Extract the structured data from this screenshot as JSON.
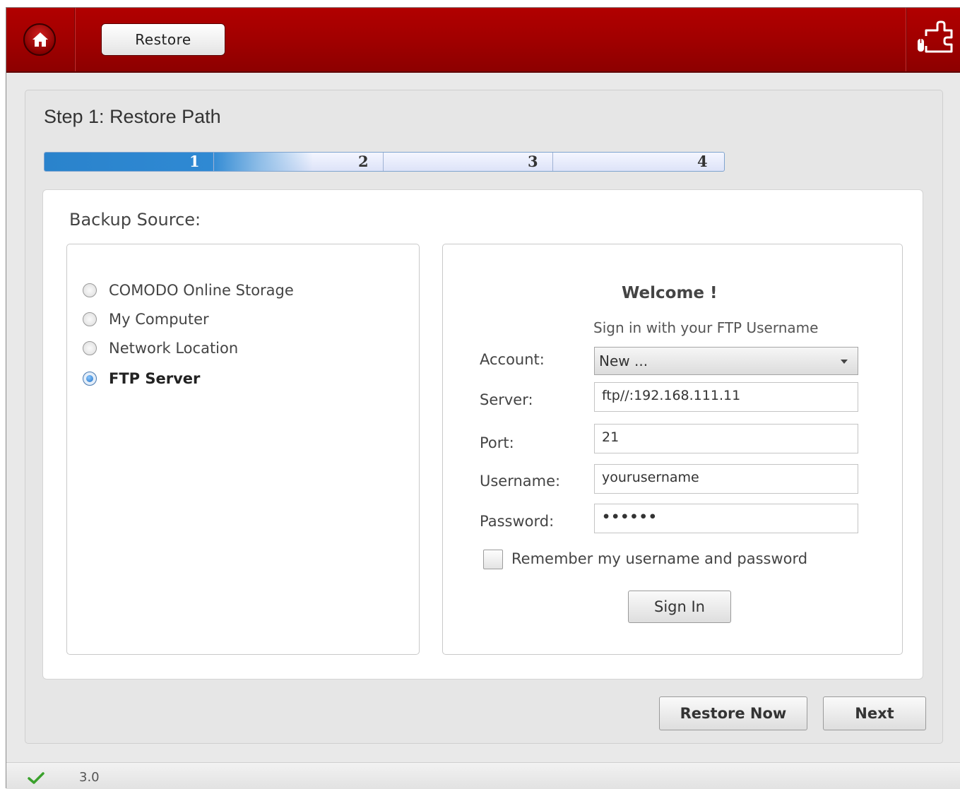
{
  "header": {
    "home_icon": "home-icon",
    "tab_label": "Restore",
    "support_icon": "puzzle-support-icon",
    "brand_color": "#a30000"
  },
  "wizard": {
    "step_title": "Step 1: Restore Path",
    "steps": [
      "1",
      "2",
      "3",
      "4"
    ],
    "current_step": 1,
    "progress_color": "#2f89d3"
  },
  "backup_source": {
    "label": "Backup Source:",
    "options": [
      {
        "label": "COMODO Online Storage",
        "selected": false
      },
      {
        "label": "My Computer",
        "selected": false
      },
      {
        "label": "Network Location",
        "selected": false
      },
      {
        "label": "FTP Server",
        "selected": true
      }
    ]
  },
  "ftp_login": {
    "welcome": "Welcome !",
    "subtitle": "Sign in with your FTP Username",
    "account_label": "Account:",
    "account_value": "New ...",
    "server_label": "Server:",
    "server_value": "ftp//:192.168.111.11",
    "port_label": "Port:",
    "port_value": "21",
    "username_label": "Username:",
    "username_value": "yourusername",
    "password_label": "Password:",
    "password_value": "••••••",
    "remember_label": "Remember my username and password",
    "remember_checked": false,
    "signin_button": "Sign In"
  },
  "footer_buttons": {
    "restore_now": "Restore Now",
    "next": "Next"
  },
  "statusbar": {
    "status_icon": "checkmark-icon",
    "version": "3.0"
  }
}
